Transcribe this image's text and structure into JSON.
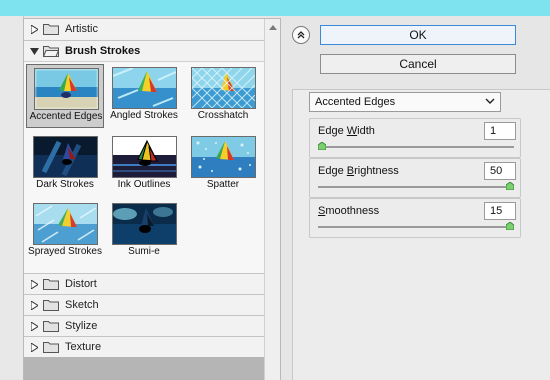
{
  "categories_top": [
    {
      "label": "Artistic",
      "expanded": false
    },
    {
      "label": "Brush Strokes",
      "expanded": true
    }
  ],
  "filters": [
    {
      "label": "Accented Edges",
      "selected": true
    },
    {
      "label": "Angled Strokes",
      "selected": false
    },
    {
      "label": "Crosshatch",
      "selected": false
    },
    {
      "label": "Dark Strokes",
      "selected": false
    },
    {
      "label": "Ink Outlines",
      "selected": false
    },
    {
      "label": "Spatter",
      "selected": false
    },
    {
      "label": "Sprayed Strokes",
      "selected": false
    },
    {
      "label": "Sumi-e",
      "selected": false
    }
  ],
  "categories_bottom": [
    {
      "label": "Distort"
    },
    {
      "label": "Sketch"
    },
    {
      "label": "Stylize"
    },
    {
      "label": "Texture"
    }
  ],
  "buttons": {
    "ok": "OK",
    "cancel": "Cancel"
  },
  "filter_select": {
    "value": "Accented Edges"
  },
  "params": [
    {
      "label_pre": "Edge ",
      "label_access": "W",
      "label_post": "idth",
      "value": "1",
      "fraction": 0.0
    },
    {
      "label_pre": "Edge ",
      "label_access": "B",
      "label_post": "rightness",
      "value": "50",
      "fraction": 1.0
    },
    {
      "label_pre": "",
      "label_access": "S",
      "label_post": "moothness",
      "value": "15",
      "fraction": 1.0
    }
  ],
  "colors": {
    "accent": "#3b8ad9",
    "topbar": "#7ee3ee"
  }
}
